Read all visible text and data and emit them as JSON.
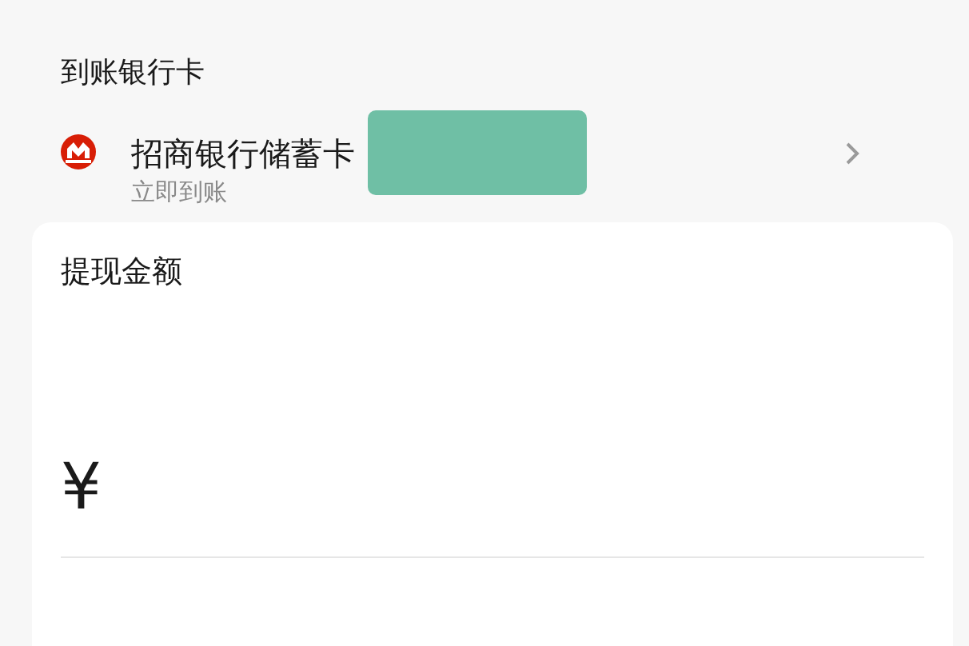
{
  "section_title": "到账银行卡",
  "bank_card": {
    "name": "招商银行储蓄卡",
    "arrival": "立即到账"
  },
  "amount": {
    "label": "提现金额",
    "currency": "¥"
  }
}
